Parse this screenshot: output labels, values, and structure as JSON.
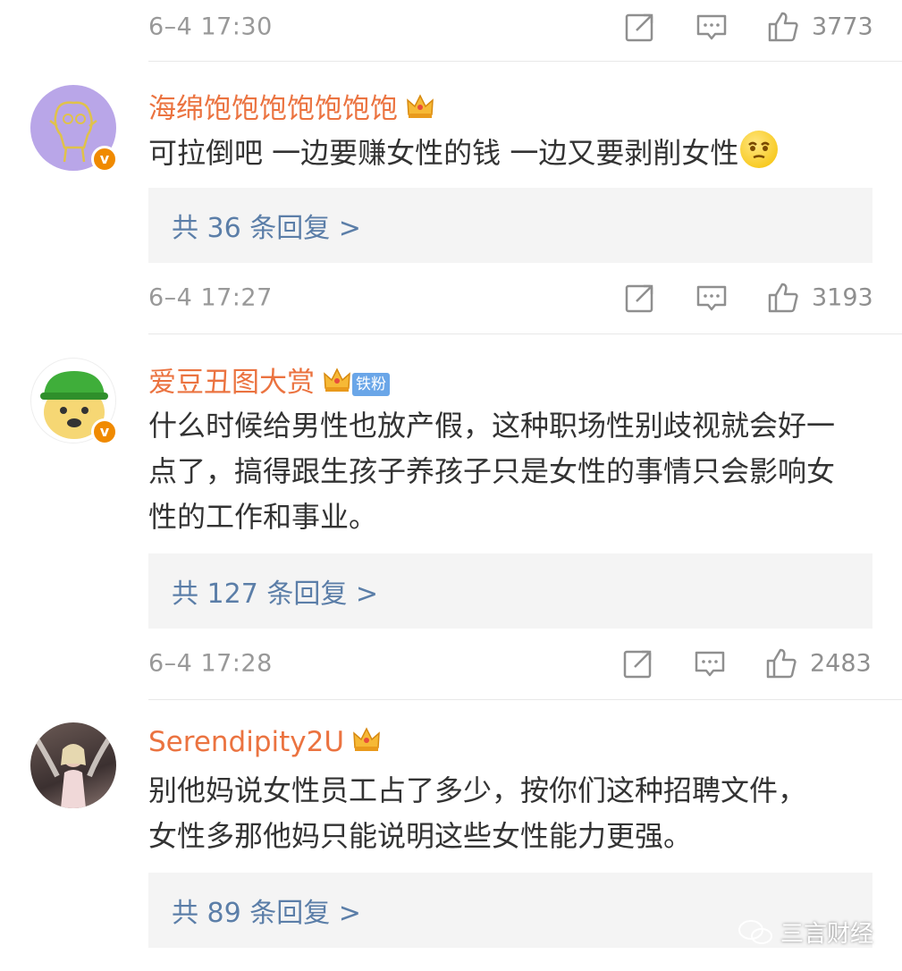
{
  "comments": [
    {
      "username": "海绵饱饱饱饱饱饱饱",
      "text": "可拉倒吧 一边要赚女性的钱 一边又要剥削女性",
      "replies_label": "共 36 条回复 >",
      "time": "6–4 17:27",
      "likes": "3193"
    },
    {
      "username": "爱豆丑图大赏",
      "fan_badge": "铁粉",
      "text": "什么时候给男性也放产假，这种职场性别歧视就会好一点了，搞得跟生孩子养孩子只是女性的事情只会影响女性的工作和事业。",
      "replies_label": "共 127 条回复 >",
      "time": "6–4 17:28",
      "likes": "2483"
    },
    {
      "username": "Serendipity2U",
      "text": "别他妈说女性员工占了多少，按你们这种招聘文件，女性多那他妈只能说明这些女性能力更强。",
      "replies_label": "共 89 条回复 >"
    }
  ],
  "top_action_bar": {
    "time": "6–4 17:30",
    "likes": "3773"
  },
  "watermark": "三言财经",
  "colors": {
    "username": "#eb7340",
    "reply_link": "#5b7ea8",
    "meta_gray": "#999999",
    "vip_badge": "#f08a00"
  }
}
